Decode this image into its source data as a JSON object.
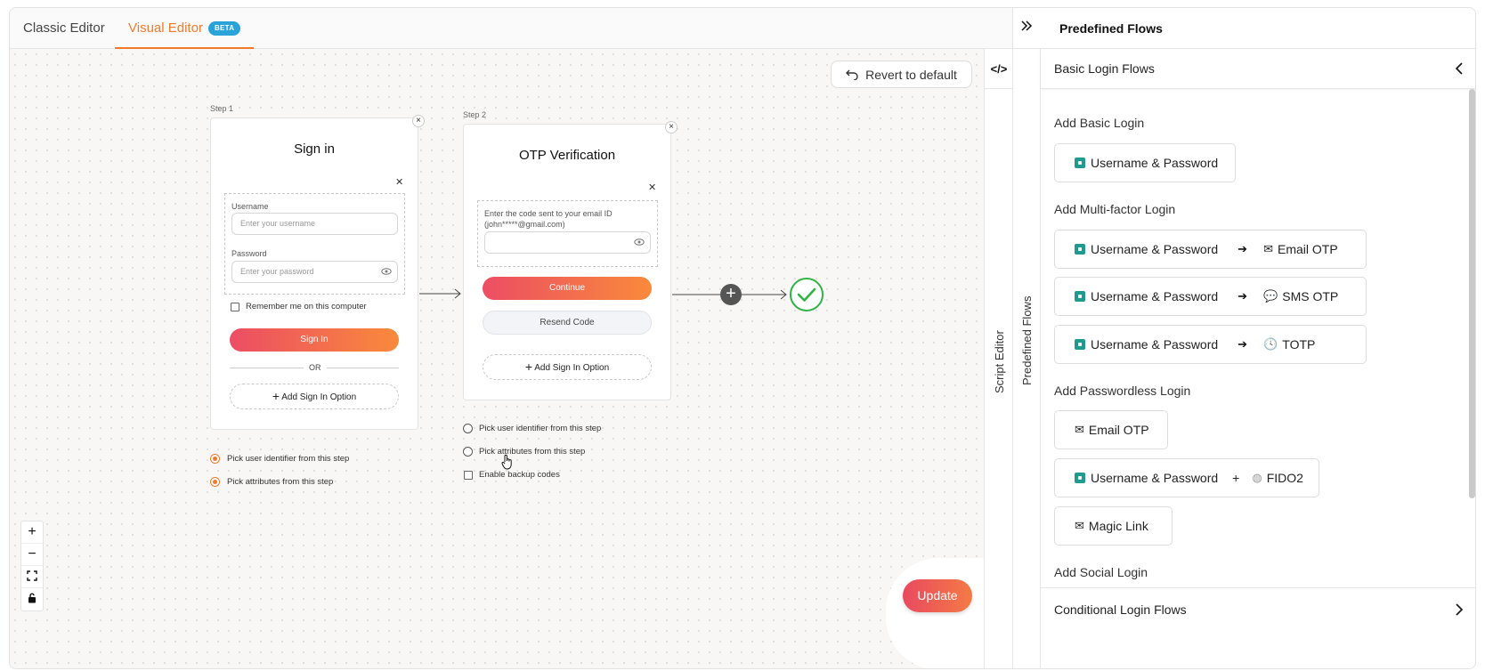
{
  "tabs": [
    {
      "label": "Classic Editor"
    },
    {
      "label": "Visual Editor",
      "badge": "BETA"
    }
  ],
  "canvas": {
    "revert_label": "Revert to default",
    "step1": {
      "step_label": "Step 1",
      "title": "Sign in",
      "username_label": "Username",
      "username_placeholder": "Enter your username",
      "password_label": "Password",
      "password_placeholder": "Enter your password",
      "remember_label": "Remember me on this computer",
      "signin_label": "Sign In",
      "or_label": "OR",
      "add_option_label": "Add Sign In Option",
      "options": [
        "Pick user identifier from this step",
        "Pick attributes from this step"
      ]
    },
    "step2": {
      "step_label": "Step 2",
      "title": "OTP Verification",
      "code_label": "Enter the code sent to your email ID (john*****@gmail.com)",
      "continue_label": "Continue",
      "resend_label": "Resend Code",
      "add_option_label": "Add Sign In Option",
      "options": [
        "Pick user identifier from this step",
        "Pick attributes from this step"
      ],
      "backup_label": "Enable backup codes"
    },
    "update_label": "Update"
  },
  "rails": {
    "script_editor": "Script Editor",
    "predefined_flows": "Predefined Flows"
  },
  "panel": {
    "title": "Predefined Flows",
    "basic_header": "Basic Login Flows",
    "conditional_header": "Conditional Login Flows",
    "sections": {
      "basic": "Add Basic Login",
      "mfa": "Add Multi-factor Login",
      "passwordless": "Add Passwordless Login",
      "social": "Add Social Login"
    },
    "flows": {
      "basic_up": "Username & Password",
      "mfa1_a": "Username & Password",
      "mfa1_b": "Email OTP",
      "mfa2_a": "Username & Password",
      "mfa2_b": "SMS OTP",
      "mfa3_a": "Username & Password",
      "mfa3_b": "TOTP",
      "pl1": "Email OTP",
      "pl2_a": "Username & Password",
      "pl2_b": "FIDO2",
      "pl3": "Magic Link"
    }
  },
  "colors": {
    "accent": "#f17a2c",
    "gradient_start": "#ec4d64",
    "gradient_end": "#f98a3b",
    "success": "#2fb344",
    "lock": "#1f9a8f",
    "beta": "#2aa3d8"
  }
}
